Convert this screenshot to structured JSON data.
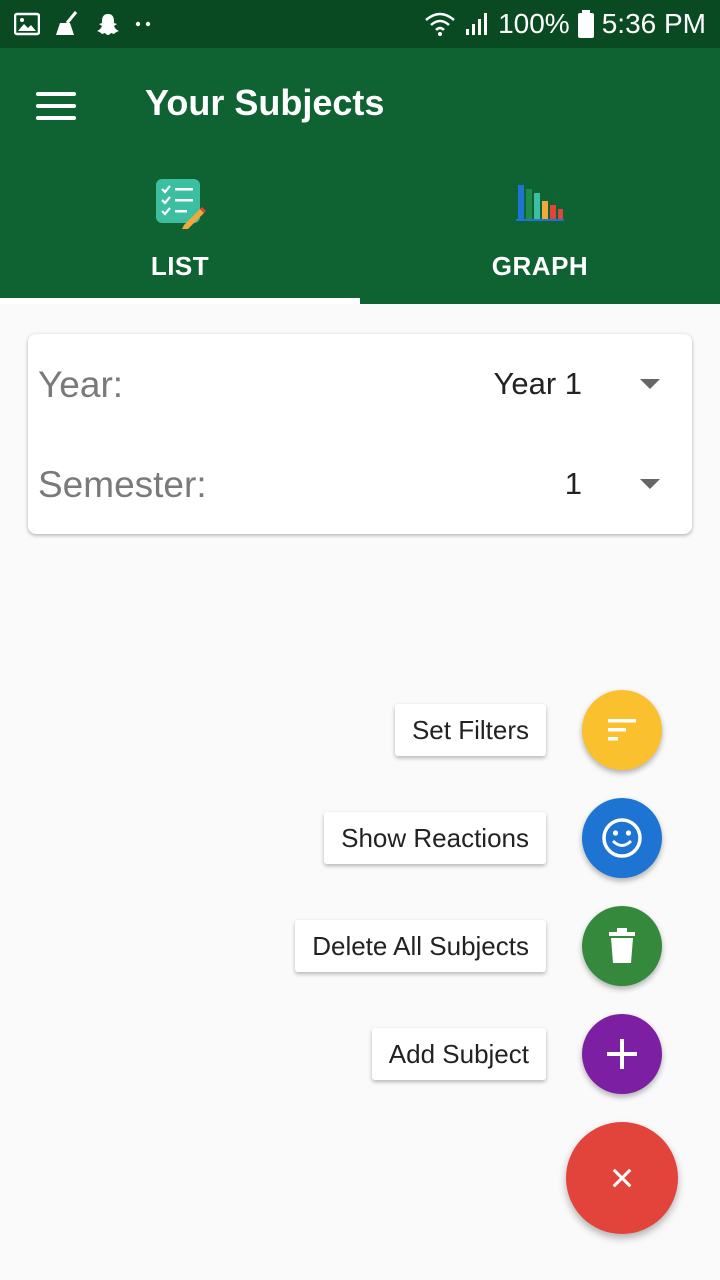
{
  "status_bar": {
    "battery": "100%",
    "time": "5:36 PM",
    "left_icons": [
      "image-icon",
      "broom-icon",
      "snapchat-icon",
      "more-dots-icon"
    ],
    "right_icons": [
      "wifi-icon",
      "signal-icon",
      "battery-icon"
    ]
  },
  "app_bar": {
    "title": "Your Subjects",
    "menu_icon": "hamburger-menu-icon",
    "color": "#0f6333"
  },
  "tabs": [
    {
      "label": "LIST",
      "icon": "checklist-icon",
      "selected": true
    },
    {
      "label": "GRAPH",
      "icon": "bar-chart-icon",
      "selected": false
    }
  ],
  "filters": {
    "year": {
      "label": "Year:",
      "value": "Year 1"
    },
    "semester": {
      "label": "Semester:",
      "value": "1"
    }
  },
  "speed_dial": {
    "items": [
      {
        "label": "Set Filters",
        "icon": "filter-icon",
        "color": "#fbc02d"
      },
      {
        "label": "Show Reactions",
        "icon": "smiley-icon",
        "color": "#1e74d2"
      },
      {
        "label": "Delete All Subjects",
        "icon": "trash-icon",
        "color": "#34893d"
      },
      {
        "label": "Add Subject",
        "icon": "plus-icon",
        "color": "#7d1fa3"
      }
    ],
    "main_icon": "close-icon",
    "main_color": "#e2433a",
    "main_symbol": "×"
  }
}
